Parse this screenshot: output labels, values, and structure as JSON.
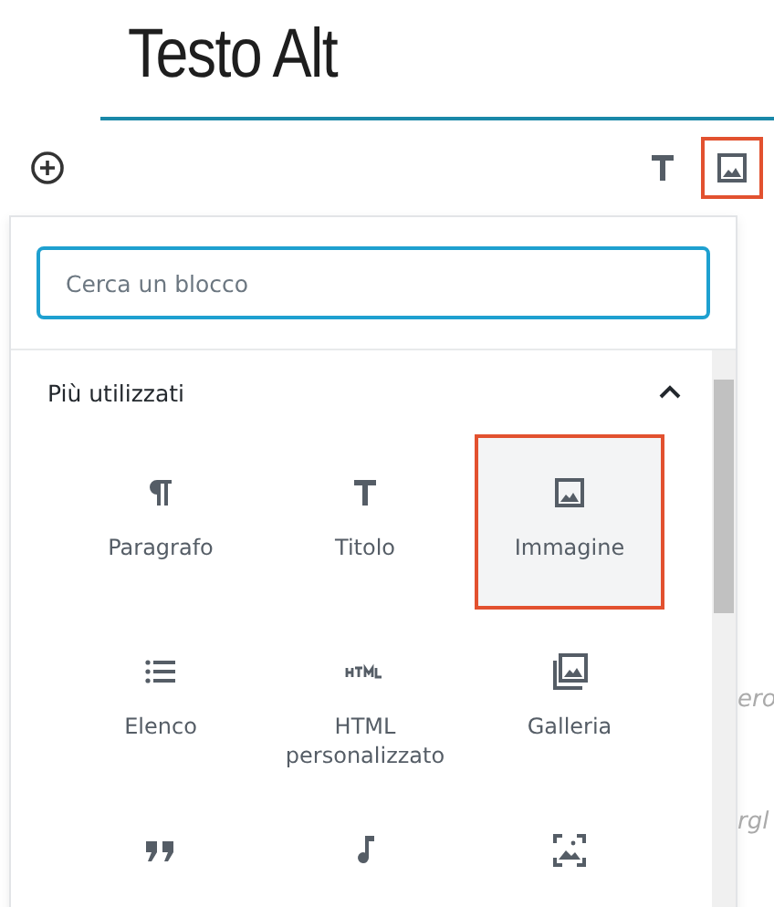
{
  "post_title": "Testo Alt",
  "toolbar": {
    "buttons": [
      {
        "kind": "heading",
        "selected": false
      },
      {
        "kind": "image",
        "selected": true
      }
    ]
  },
  "inserter": {
    "search": {
      "placeholder": "Cerca un blocco"
    },
    "section": {
      "title": "Più utilizzati",
      "expanded": true
    },
    "blocks": [
      {
        "kind": "paragraph",
        "label": "Paragrafo",
        "selected": false
      },
      {
        "kind": "heading",
        "label": "Titolo",
        "selected": false
      },
      {
        "kind": "image",
        "label": "Immagine",
        "selected": true
      },
      {
        "kind": "list",
        "label": "Elenco",
        "selected": false
      },
      {
        "kind": "html",
        "label": "HTML personalizzato",
        "selected": false
      },
      {
        "kind": "gallery",
        "label": "Galleria",
        "selected": false
      },
      {
        "kind": "quote",
        "selected": false
      },
      {
        "kind": "audio",
        "selected": false
      },
      {
        "kind": "cover",
        "selected": false
      }
    ]
  },
  "background_fragments": [
    "ero",
    "rgl"
  ]
}
